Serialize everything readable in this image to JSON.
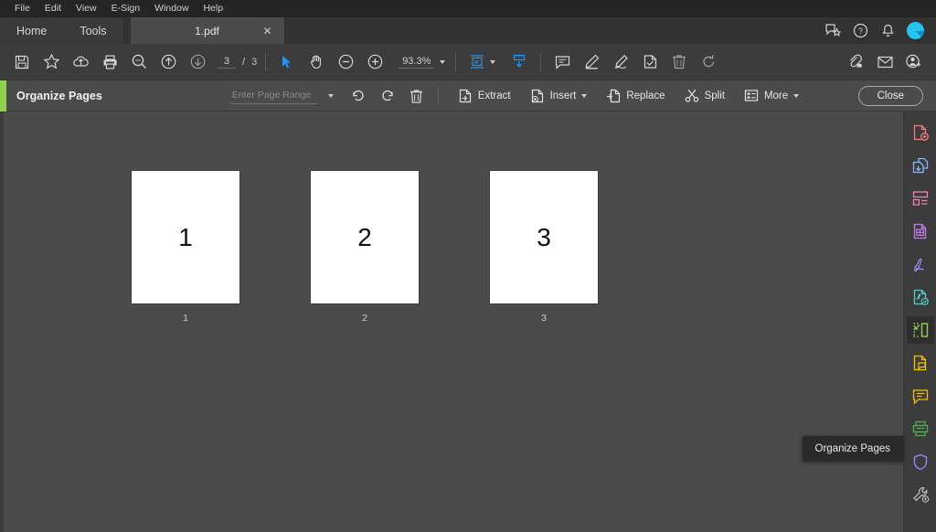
{
  "menubar": {
    "items": [
      {
        "label": "File"
      },
      {
        "label": "Edit"
      },
      {
        "label": "View"
      },
      {
        "label": "E-Sign"
      },
      {
        "label": "Window"
      },
      {
        "label": "Help"
      }
    ]
  },
  "tabbar": {
    "home_label": "Home",
    "tools_label": "Tools",
    "document_tab": {
      "label": "1.pdf",
      "close_glyph": "✕"
    },
    "actions": [
      "feedback-icon",
      "help-icon",
      "bell-icon",
      "avatar"
    ]
  },
  "toolbar": {
    "buttons": [
      {
        "name": "save-icon"
      },
      {
        "name": "star-icon"
      },
      {
        "name": "cloud-upload-icon"
      },
      {
        "name": "print-icon"
      },
      {
        "name": "search-icon"
      },
      {
        "name": "previous-page-icon"
      },
      {
        "name": "next-page-icon"
      }
    ],
    "page_current": "3",
    "page_separator": "/",
    "page_total": "3",
    "select_tool": "select-cursor-icon",
    "hand_tool": "hand-icon",
    "zoom_out": "zoom-out-icon",
    "zoom_in": "zoom-in-icon",
    "zoom_value": "93.3%",
    "fit_page_icon": "fit-page-icon",
    "scroll_mode_icon": "scroll-mode-icon",
    "right_tools": [
      {
        "name": "comment-icon"
      },
      {
        "name": "highlight-icon"
      },
      {
        "name": "draw-icon"
      },
      {
        "name": "stamp-icon"
      },
      {
        "name": "delete-icon"
      },
      {
        "name": "rotate-icon"
      }
    ],
    "far_right_tools": [
      {
        "name": "share-link-icon"
      },
      {
        "name": "email-icon"
      },
      {
        "name": "add-person-icon"
      }
    ]
  },
  "organize_bar": {
    "title": "Organize Pages",
    "page_range_placeholder": "Enter Page Range",
    "page_range_value": "",
    "undo_icon": "undo-icon",
    "redo_icon": "redo-icon",
    "delete_icon": "trash-icon",
    "actions": [
      {
        "label": "Extract",
        "icon": "extract-icon",
        "dropdown": false
      },
      {
        "label": "Insert",
        "icon": "insert-icon",
        "dropdown": true
      },
      {
        "label": "Replace",
        "icon": "replace-icon",
        "dropdown": false
      },
      {
        "label": "Split",
        "icon": "split-icon",
        "dropdown": false
      },
      {
        "label": "More",
        "icon": "more-icon",
        "dropdown": true
      }
    ],
    "close_label": "Close",
    "accent_color": "#8fd14f"
  },
  "canvas": {
    "pages": [
      {
        "content": "1",
        "caption": "1"
      },
      {
        "content": "2",
        "caption": "2"
      },
      {
        "content": "3",
        "caption": "3"
      }
    ]
  },
  "right_sidebar": {
    "items": [
      {
        "name": "create-pdf-icon",
        "color": "#f08080"
      },
      {
        "name": "combine-files-icon",
        "color": "#8ab4f8"
      },
      {
        "name": "edit-pdf-icon",
        "color": "#f47fb0"
      },
      {
        "name": "export-pdf-icon",
        "color": "#c07fe8"
      },
      {
        "name": "fill-and-sign-icon",
        "color": "#9b87f5"
      },
      {
        "name": "send-for-signature-icon",
        "color": "#4dd0c4"
      },
      {
        "name": "organize-pages-icon",
        "color": "#8fd14f",
        "active": true
      },
      {
        "name": "page-comment-icon",
        "color": "#f2c200"
      },
      {
        "name": "comment-icon",
        "color": "#f2c200"
      },
      {
        "name": "scan-and-ocr-icon",
        "color": "#4caf50"
      },
      {
        "name": "protect-icon",
        "color": "#9b87f5"
      },
      {
        "name": "more-tools-icon",
        "color": "#b8b8b8"
      }
    ]
  },
  "tooltip": {
    "text": "Organize Pages"
  }
}
